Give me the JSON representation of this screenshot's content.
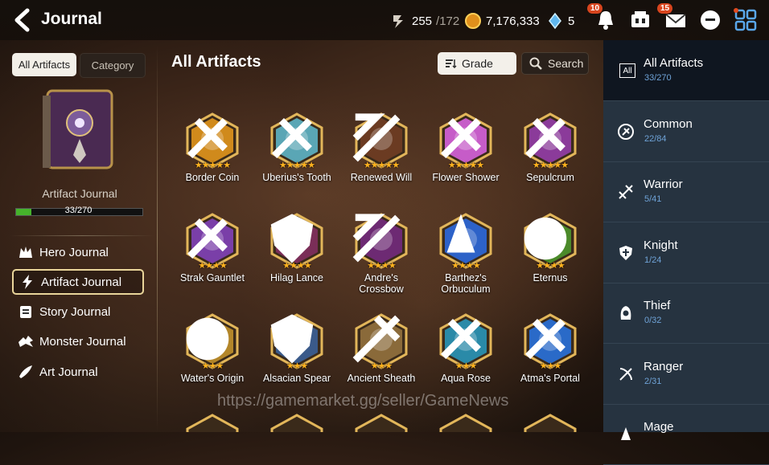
{
  "header": {
    "title": "Journal",
    "stamina": "255",
    "stamina_max": "/172",
    "gold": "7,176,333",
    "skystones": "5",
    "notif_badge": "10",
    "mail_badge": "15"
  },
  "left": {
    "tabs": [
      "All Artifacts",
      "Category"
    ],
    "book_label": "Artifact Journal",
    "progress": "33/270",
    "progress_fraction": 0.122,
    "nav": [
      "Hero Journal",
      "Artifact Journal",
      "Story Journal",
      "Monster Journal",
      "Art Journal"
    ]
  },
  "main": {
    "title": "All Artifacts",
    "sort_label": "Grade",
    "search_label": "Search",
    "artifacts": [
      {
        "name": "Border Coin",
        "stars": "★★★★★",
        "class": "common",
        "color": "#d08a1c"
      },
      {
        "name": "Uberius's Tooth",
        "stars": "★★★★★",
        "class": "common",
        "color": "#5aa6b5"
      },
      {
        "name": "Renewed Will",
        "stars": "★★★★★",
        "class": "ranger",
        "color": "#6b3b22"
      },
      {
        "name": "Flower Shower",
        "stars": "★★★★★",
        "class": "common",
        "color": "#c65cc8"
      },
      {
        "name": "Sepulcrum",
        "stars": "★★★★★",
        "class": "common",
        "color": "#8b3b9a"
      },
      {
        "name": "Strak Gauntlet",
        "stars": "★★★★",
        "class": "common",
        "color": "#7a3fa8"
      },
      {
        "name": "Hilag Lance",
        "stars": "★★★★",
        "class": "knight",
        "color": "#7a2e58"
      },
      {
        "name": "Andre's\nCrossbow",
        "stars": "★★★★",
        "class": "ranger",
        "color": "#6d2a73"
      },
      {
        "name": "Barthez's\nOrbuculum",
        "stars": "★★★★",
        "class": "mage",
        "color": "#2d62c8"
      },
      {
        "name": "Eternus",
        "stars": "★★★★",
        "class": "soul",
        "color": "#4b8a2a"
      },
      {
        "name": "Water's Origin",
        "stars": "★★★",
        "class": "soul",
        "color": "#b3862a"
      },
      {
        "name": "Alsacian Spear",
        "stars": "★★★",
        "class": "knight",
        "color": "#3a5a8a"
      },
      {
        "name": "Ancient Sheath",
        "stars": "★★★",
        "class": "warrior",
        "color": "#8a6a3a"
      },
      {
        "name": "Aqua Rose",
        "stars": "★★★",
        "class": "common",
        "color": "#2a8aa8"
      },
      {
        "name": "Atma's Portal",
        "stars": "★★★",
        "class": "common",
        "color": "#2a6ac8"
      }
    ]
  },
  "categories": [
    {
      "name": "All Artifacts",
      "count": "33/270",
      "icon": "All"
    },
    {
      "name": "Common",
      "count": "22/84"
    },
    {
      "name": "Warrior",
      "count": "5/41"
    },
    {
      "name": "Knight",
      "count": "1/24"
    },
    {
      "name": "Thief",
      "count": "0/32"
    },
    {
      "name": "Ranger",
      "count": "2/31"
    },
    {
      "name": "Mage",
      "count": ""
    }
  ],
  "watermark": "https://gamemarket.gg/seller/GameNews",
  "colors": {
    "accent": "#e9d59a",
    "panel": "#263340",
    "count": "#6fa3d7",
    "star": "#ffb21e"
  }
}
